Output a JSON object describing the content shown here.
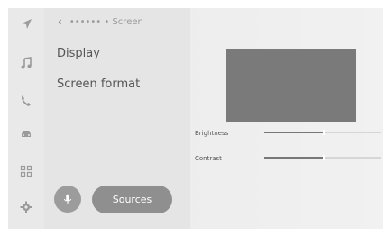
{
  "header": {
    "back_glyph": "‹",
    "breadcrumb": "•••••• • Screen"
  },
  "menu": {
    "items": [
      {
        "label": "Display"
      },
      {
        "label": "Screen format"
      }
    ]
  },
  "rail": {
    "icons": [
      "navigation-icon",
      "music-icon",
      "phone-icon",
      "car-icon",
      "apps-icon",
      "settings-icon"
    ]
  },
  "voice": {
    "icon": "microphone-icon"
  },
  "sources_button": {
    "label": "Sources"
  },
  "settings": {
    "brightness": {
      "label": "Brightness",
      "level": 0.5
    },
    "contrast": {
      "label": "Contrast",
      "level": 0.5
    }
  },
  "colors": {
    "accent": "#8f8f8f",
    "preview": "#7a7a7a"
  }
}
